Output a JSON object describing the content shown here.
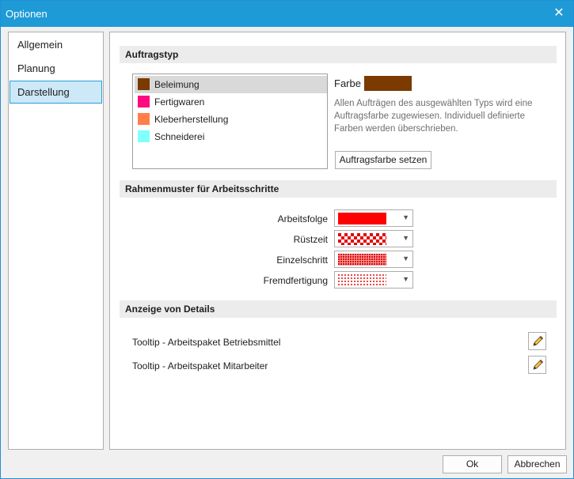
{
  "window": {
    "title": "Optionen"
  },
  "nav": {
    "items": [
      {
        "label": "Allgemein"
      },
      {
        "label": "Planung"
      },
      {
        "label": "Darstellung"
      }
    ],
    "selected": "Darstellung"
  },
  "auftragstyp": {
    "header": "Auftragstyp",
    "items": [
      {
        "label": "Beleimung",
        "color": "#7a3a00"
      },
      {
        "label": "Fertigwaren",
        "color": "#ff0a7f"
      },
      {
        "label": "Kleberherstellung",
        "color": "#ff7f4a"
      },
      {
        "label": "Schneiderei",
        "color": "#80ffff"
      }
    ],
    "selected": "Beleimung",
    "farbe_label": "Farbe",
    "farbe_color": "#7a3a00",
    "description": "Allen Aufträgen des ausgewählten Typs wird eine Auftragsfarbe zugewiesen. Individuell definierte Farben werden überschrieben.",
    "set_color_button": "Auftragsfarbe setzen"
  },
  "rahmenmuster": {
    "header": "Rahmenmuster für Arbeitsschritte",
    "rows": [
      {
        "label": "Arbeitsfolge",
        "pattern": "solid"
      },
      {
        "label": "Rüstzeit",
        "pattern": "checker"
      },
      {
        "label": "Einzelschritt",
        "pattern": "dense-dots"
      },
      {
        "label": "Fremdfertigung",
        "pattern": "sparse-dots"
      }
    ],
    "pattern_color": "#ff0000"
  },
  "details": {
    "header": "Anzeige von Details",
    "rows": [
      {
        "label": "Tooltip - Arbeitspaket Betriebsmittel",
        "icon": "pencil-icon"
      },
      {
        "label": "Tooltip - Arbeitspaket Mitarbeiter",
        "icon": "pencil-icon"
      }
    ]
  },
  "footer": {
    "ok_label": "Ok",
    "cancel_label": "Abbrechen"
  }
}
